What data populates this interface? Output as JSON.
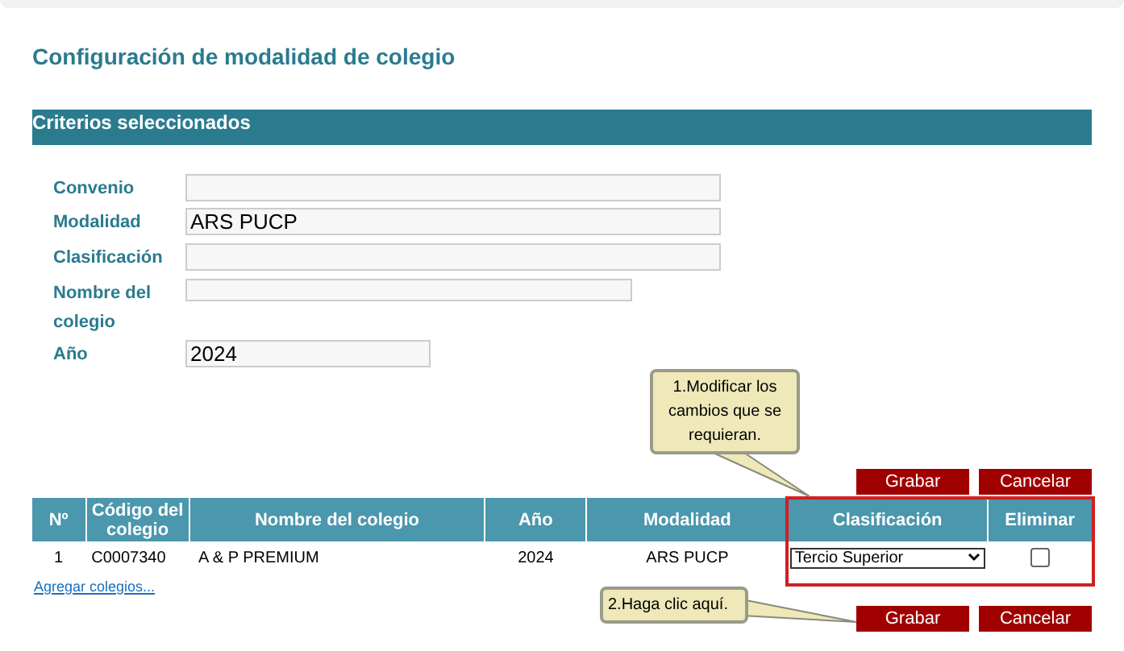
{
  "page_title": "Configuración de modalidad de colegio",
  "section": {
    "title": "Criterios seleccionados"
  },
  "fields": [
    {
      "label": "Convenio",
      "kind": "wide"
    },
    {
      "label": "Modalidad",
      "kind": "wide",
      "value": "ARS PUCP"
    },
    {
      "label": "Clasificación",
      "kind": "wide"
    },
    {
      "label": "Nombre del colegio",
      "kind": "narrow"
    },
    {
      "label": "Año",
      "kind": "short",
      "value": "2024"
    }
  ],
  "top_buttons": [
    "Grabar",
    "Cancelar"
  ],
  "table": {
    "columns": [
      "Nº",
      "Código del colegio",
      "Nombre del colegio",
      "Año",
      "Modalidad",
      "Clasificación",
      "Eliminar"
    ],
    "rows": [
      {
        "number": "1",
        "code": "C0007340",
        "name": "A & P PREMIUM",
        "year": "2024",
        "modalidad": "ARS PUCP",
        "clasificacion": "Tercio Superior",
        "eliminar_checked": false
      }
    ]
  },
  "add_link": "Agregar colegios...",
  "bottom_buttons": [
    "Grabar",
    "Cancelar"
  ],
  "callouts": [
    "1.Modificar los cambios que se requieran.",
    "2.Haga clic aquí."
  ]
}
